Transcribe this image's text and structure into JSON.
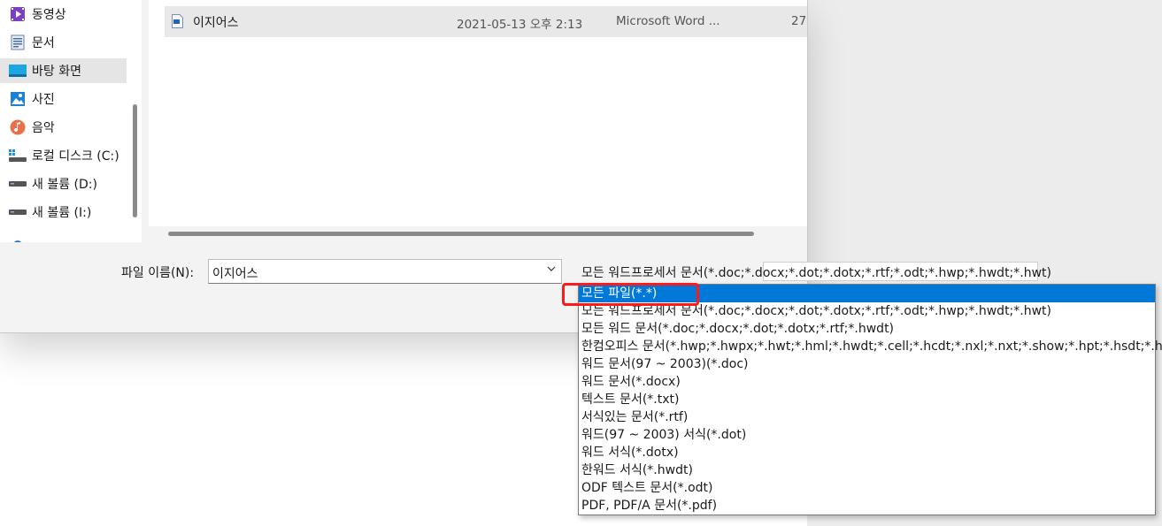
{
  "nav": {
    "items": [
      {
        "label": "동영상",
        "icon": "video-icon",
        "selected": false
      },
      {
        "label": "문서",
        "icon": "document-icon",
        "selected": false
      },
      {
        "label": "바탕 화면",
        "icon": "desktop-icon",
        "selected": true
      },
      {
        "label": "사진",
        "icon": "pictures-icon",
        "selected": false
      },
      {
        "label": "음악",
        "icon": "music-icon",
        "selected": false
      },
      {
        "label": "로컬 디스크 (C:)",
        "icon": "drive-icon",
        "selected": false
      },
      {
        "label": "새 볼륨 (D:)",
        "icon": "drive-icon",
        "selected": false
      },
      {
        "label": "새 볼륨 (I:)",
        "icon": "drive-icon",
        "selected": false
      }
    ]
  },
  "files": [
    {
      "name": "이지어스",
      "date": "2021-05-13 오후 2:13",
      "type": "Microsoft Word ...",
      "size": "27",
      "icon": "word-document-icon"
    }
  ],
  "filename": {
    "label": "파일 이름(N):",
    "value": "이지어스"
  },
  "filetype": {
    "selected": "모든 워드프로세서 문서(*.doc;*.docx;*.dot;*.dotx;*.rtf;*.odt;*.hwp;*.hwdt;*.hwt)",
    "options": [
      "모든 파일(*.*)",
      "모든 워드프로세서 문서(*.doc;*.docx;*.dot;*.dotx;*.rtf;*.odt;*.hwp;*.hwdt;*.hwt)",
      "모든 워드 문서(*.doc;*.docx;*.dot;*.dotx;*.rtf;*.hwdt)",
      "한컴오피스 문서(*.hwp;*.hwpx;*.hwt;*.hml;*.hwdt;*.cell;*.hcdt;*.nxl;*.nxt;*.show;*.hpt;*.hsdt;*.hteme)",
      "워드 문서(97 ~ 2003)(*.doc)",
      "워드 문서(*.docx)",
      "텍스트 문서(*.txt)",
      "서식있는 문서(*.rtf)",
      "워드(97 ~ 2003) 서식(*.dot)",
      "워드 서식(*.dotx)",
      "한워드 서식(*.hwdt)",
      "ODF 텍스트 문서(*.odt)",
      "PDF, PDF/A 문서(*.pdf)"
    ],
    "highlighted_index": 0
  },
  "colors": {
    "accent": "#0078d7",
    "annotation": "#ff1a1a"
  }
}
